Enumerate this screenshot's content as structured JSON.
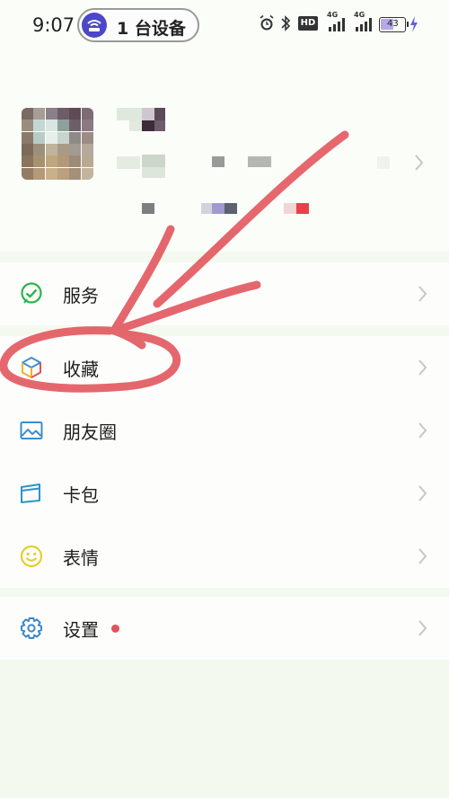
{
  "status_bar": {
    "time": "9:07",
    "device_pill": "1 台设备",
    "net1": "4G",
    "net2": "4G",
    "hd": "HD",
    "battery": "43"
  },
  "colors": {
    "annotation": "#e0464f",
    "router_badge": "#4c46c8",
    "service_icon": "#2fb24d",
    "red_dot": "#e4525a"
  },
  "menu": {
    "services": "服务",
    "favorites": "收藏",
    "moments": "朋友圈",
    "cards": "卡包",
    "stickers": "表情",
    "settings": "设置"
  }
}
